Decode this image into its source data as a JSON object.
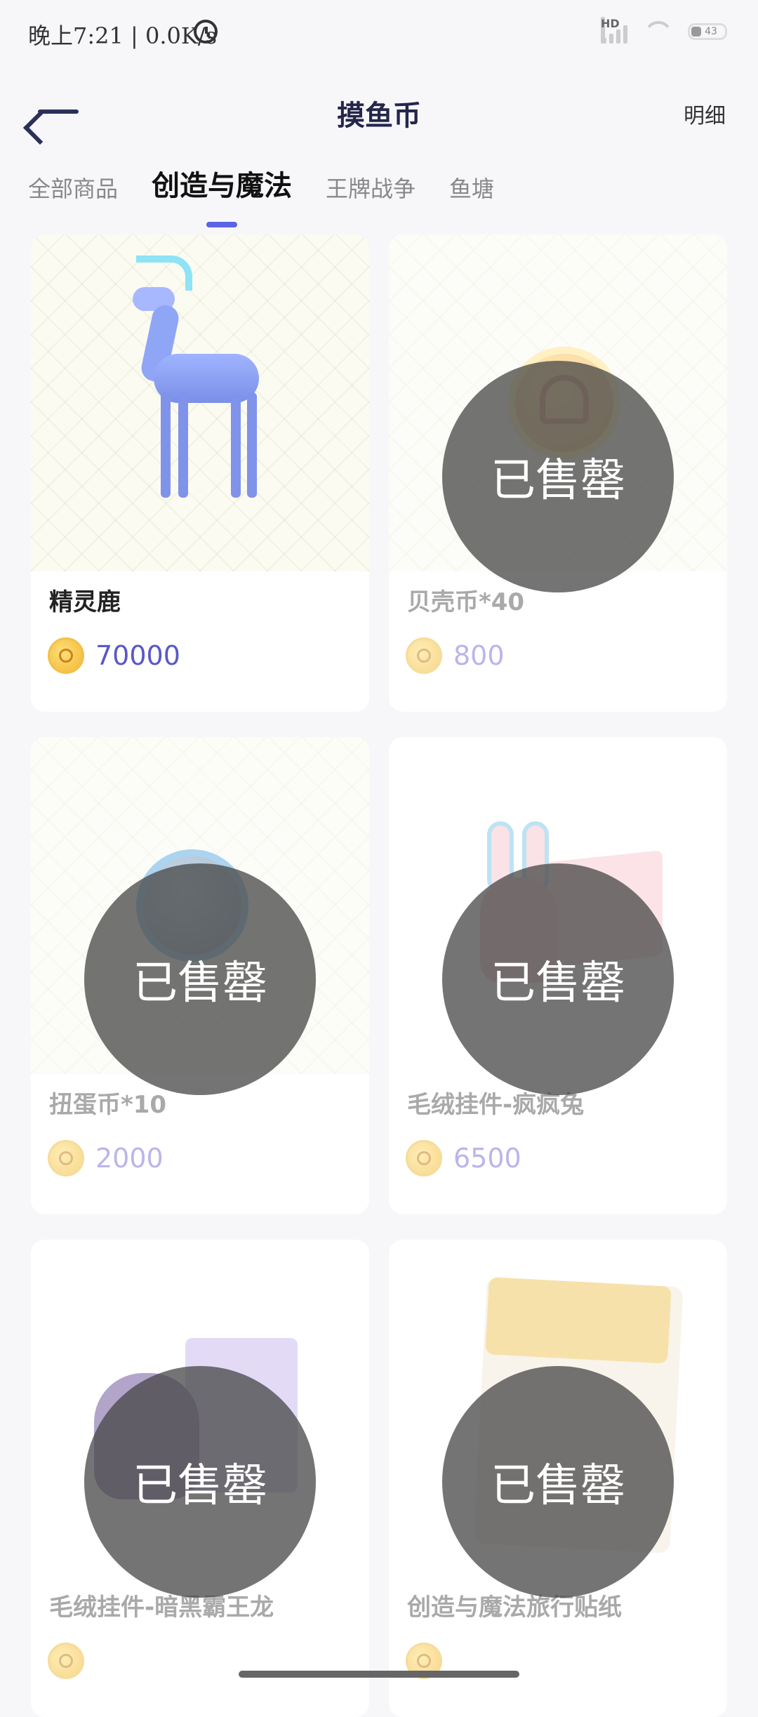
{
  "status_bar": {
    "time_speed": "晚上7:21 | 0.0K/s",
    "network_label": "HD",
    "battery_level": "43"
  },
  "header": {
    "title": "摸鱼币",
    "detail_link": "明细"
  },
  "tabs": [
    {
      "label": "全部商品",
      "active": false
    },
    {
      "label": "创造与魔法",
      "active": true
    },
    {
      "label": "王牌战争",
      "active": false
    },
    {
      "label": "鱼塘",
      "active": false
    }
  ],
  "products": [
    {
      "name": "精灵鹿",
      "price": "70000",
      "sold_out": false,
      "image": "deer"
    },
    {
      "name": "贝壳币*40",
      "price": "800",
      "sold_out": true,
      "image": "shell-coin"
    },
    {
      "name": "扭蛋币*10",
      "price": "2000",
      "sold_out": true,
      "image": "gacha-coin"
    },
    {
      "name": "毛绒挂件-疯疯兔",
      "price": "6500",
      "sold_out": true,
      "image": "plush-bunny"
    },
    {
      "name": "毛绒挂件-暗黑霸王龙",
      "price": "",
      "sold_out": true,
      "image": "plush-dragon"
    },
    {
      "name": "创造与魔法旅行贴纸",
      "price": "",
      "sold_out": true,
      "image": "travel-sticker"
    }
  ],
  "sold_out_label": "已售罄",
  "colors": {
    "accent": "#5b63e6",
    "price": "#5b57c8",
    "title": "#24264a"
  }
}
